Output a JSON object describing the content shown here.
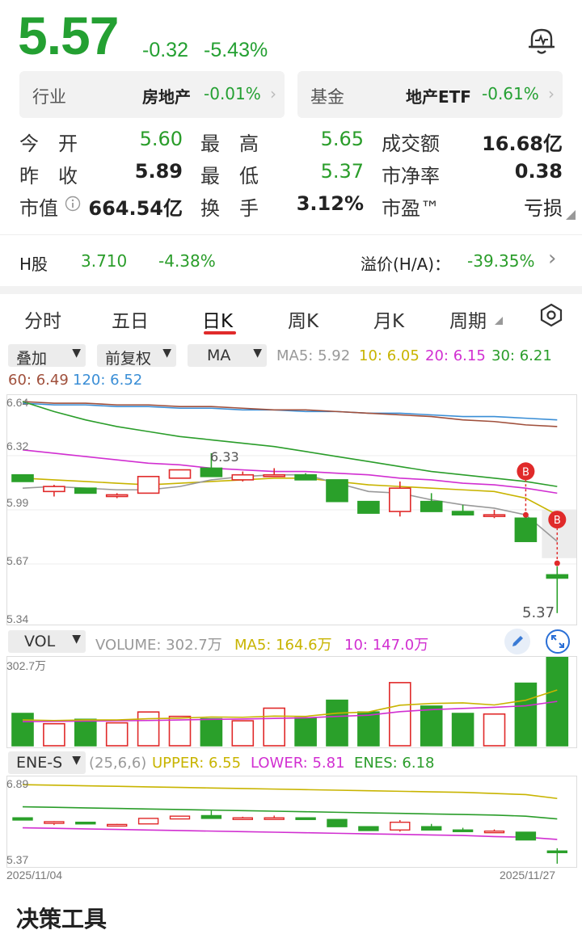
{
  "quote": {
    "price": "5.57",
    "change": "-0.32",
    "change_pct": "-5.43%"
  },
  "industry": {
    "label": "行业",
    "name": "房地产",
    "change": "-0.01%",
    "chevron": "›"
  },
  "fund": {
    "label": "基金",
    "name": "地产ETF",
    "change": "-0.61%",
    "chevron": "›"
  },
  "stats": {
    "open_label": "今　开",
    "open": "5.60",
    "high_label": "最　高",
    "high": "5.65",
    "turnover_label": "成交额",
    "turnover": "16.68亿",
    "prev_label": "昨　收",
    "prev": "5.89",
    "low_label": "最　低",
    "low": "5.37",
    "pb_label": "市净率",
    "pb": "0.38",
    "mcap_label": "市值",
    "mcap": "664.54亿",
    "turnrate_label": "换　手",
    "turnrate": "3.12%",
    "pe_label": "市盈™",
    "pe": "亏损"
  },
  "hshare": {
    "label": "H股",
    "price": "3.710",
    "change": "-4.38%",
    "premium_label": "溢价(H/A)：",
    "premium": "-39.35%",
    "chevron": "›"
  },
  "tabs": [
    "分时",
    "五日",
    "日K",
    "周K",
    "月K",
    "周期"
  ],
  "controls": {
    "overlay": "叠加",
    "adjust": "前复权",
    "indicator": "MA"
  },
  "ma": {
    "ma5": "MA5: 5.92",
    "ma10": "10: 6.05",
    "ma20": "20: 6.15",
    "ma30": "30: 6.21",
    "ma60": "60: 6.49",
    "ma120": "120: 6.52"
  },
  "kline_axis": [
    "6.64",
    "6.32",
    "5.99",
    "5.67",
    "5.34"
  ],
  "kline_labels": {
    "high_mark": "6.33",
    "low_mark": "5.37",
    "buy1": "B",
    "buy2": "B"
  },
  "vol": {
    "selector": "VOL",
    "volume": "VOLUME: 302.7万",
    "ma5": "MA5: 164.6万",
    "ma10": "10: 147.0万",
    "axis_top": "302.7万"
  },
  "ene": {
    "selector": "ENE-S",
    "params": "(25,6,6)",
    "upper": "UPPER: 6.55",
    "lower": "LOWER: 5.81",
    "enes": "ENES: 6.18",
    "axis_top": "6.89",
    "axis_bottom": "5.37"
  },
  "dates": {
    "start": "2025/11/04",
    "end": "2025/11/27"
  },
  "footer": {
    "logo": "决策工具"
  },
  "colors": {
    "up": "#e02a2a",
    "down": "#2aa02a",
    "ma5": "#999999",
    "ma10": "#c8b400",
    "ma20": "#d12fd1",
    "ma30": "#2a9d2a",
    "ma60": "#a0503c",
    "ma120": "#3a8ed6"
  },
  "chart_data": {
    "type": "candlestick",
    "candles": [
      {
        "o": 6.2,
        "c": 6.16,
        "h": 6.2,
        "l": 6.16
      },
      {
        "o": 6.1,
        "c": 6.13,
        "h": 6.14,
        "l": 6.07
      },
      {
        "o": 6.12,
        "c": 6.09,
        "h": 6.12,
        "l": 6.09
      },
      {
        "o": 6.07,
        "c": 6.08,
        "h": 6.09,
        "l": 6.06
      },
      {
        "o": 6.09,
        "c": 6.19,
        "h": 6.19,
        "l": 6.09
      },
      {
        "o": 6.18,
        "c": 6.23,
        "h": 6.23,
        "l": 6.18
      },
      {
        "o": 6.24,
        "c": 6.19,
        "h": 6.33,
        "l": 6.19
      },
      {
        "o": 6.17,
        "c": 6.2,
        "h": 6.22,
        "l": 6.16
      },
      {
        "o": 6.19,
        "c": 6.2,
        "h": 6.24,
        "l": 6.19
      },
      {
        "o": 6.2,
        "c": 6.17,
        "h": 6.21,
        "l": 6.17
      },
      {
        "o": 6.17,
        "c": 6.04,
        "h": 6.17,
        "l": 6.04
      },
      {
        "o": 6.04,
        "c": 5.97,
        "h": 6.04,
        "l": 5.97
      },
      {
        "o": 5.98,
        "c": 6.12,
        "h": 6.16,
        "l": 5.95
      },
      {
        "o": 6.04,
        "c": 5.98,
        "h": 6.09,
        "l": 5.98
      },
      {
        "o": 5.98,
        "c": 5.96,
        "h": 6.02,
        "l": 5.96
      },
      {
        "o": 5.96,
        "c": 5.96,
        "h": 5.99,
        "l": 5.94
      },
      {
        "o": 5.94,
        "c": 5.8,
        "h": 5.94,
        "l": 5.8
      },
      {
        "o": 5.6,
        "c": 5.58,
        "h": 5.65,
        "l": 5.37
      }
    ],
    "ma5": [
      6.12,
      6.13,
      6.12,
      6.11,
      6.11,
      6.13,
      6.17,
      6.19,
      6.2,
      6.2,
      6.15,
      6.1,
      6.09,
      6.05,
      6.02,
      6.0,
      5.96,
      5.8
    ],
    "ma10": [
      6.18,
      6.17,
      6.16,
      6.15,
      6.14,
      6.15,
      6.16,
      6.17,
      6.18,
      6.18,
      6.16,
      6.14,
      6.13,
      6.12,
      6.11,
      6.1,
      6.06,
      5.96
    ],
    "ma20": [
      6.35,
      6.33,
      6.31,
      6.29,
      6.27,
      6.26,
      6.24,
      6.23,
      6.22,
      6.22,
      6.21,
      6.2,
      6.18,
      6.17,
      6.15,
      6.14,
      6.12,
      6.09
    ],
    "ma30": [
      6.64,
      6.58,
      6.53,
      6.49,
      6.46,
      6.43,
      6.41,
      6.39,
      6.37,
      6.34,
      6.31,
      6.28,
      6.25,
      6.22,
      6.2,
      6.18,
      6.16,
      6.13
    ],
    "ma60": [
      6.64,
      6.63,
      6.63,
      6.62,
      6.62,
      6.61,
      6.61,
      6.6,
      6.59,
      6.59,
      6.58,
      6.57,
      6.56,
      6.55,
      6.53,
      6.52,
      6.5,
      6.49
    ],
    "ma120": [
      6.63,
      6.62,
      6.62,
      6.61,
      6.61,
      6.6,
      6.6,
      6.59,
      6.59,
      6.58,
      6.58,
      6.57,
      6.57,
      6.56,
      6.55,
      6.55,
      6.54,
      6.53
    ],
    "volumes": [
      110,
      75,
      90,
      78,
      115,
      100,
      92,
      85,
      128,
      95,
      155,
      115,
      215,
      135,
      110,
      108,
      213,
      302.7
    ],
    "vol_ma5": [
      88,
      86,
      88,
      88,
      92,
      94,
      98,
      97,
      101,
      100,
      111,
      115,
      138,
      144,
      146,
      139,
      155,
      190
    ],
    "vol_ma10": [
      82,
      83,
      84,
      85,
      86,
      88,
      90,
      91,
      93,
      95,
      100,
      104,
      116,
      123,
      127,
      131,
      136,
      151
    ],
    "ene_upper": [
      6.8,
      6.79,
      6.78,
      6.77,
      6.76,
      6.75,
      6.74,
      6.73,
      6.72,
      6.71,
      6.7,
      6.69,
      6.68,
      6.67,
      6.66,
      6.64,
      6.62,
      6.55
    ],
    "ene_mid": [
      6.4,
      6.39,
      6.38,
      6.37,
      6.36,
      6.35,
      6.34,
      6.33,
      6.32,
      6.31,
      6.3,
      6.29,
      6.28,
      6.27,
      6.26,
      6.25,
      6.23,
      6.18
    ],
    "ene_lower": [
      6.02,
      6.01,
      6.0,
      5.99,
      5.98,
      5.97,
      5.96,
      5.95,
      5.94,
      5.93,
      5.92,
      5.91,
      5.9,
      5.89,
      5.88,
      5.86,
      5.85,
      5.81
    ],
    "kline_ylim": [
      5.34,
      6.64
    ],
    "ene_ylim": [
      5.37,
      6.89
    ]
  }
}
